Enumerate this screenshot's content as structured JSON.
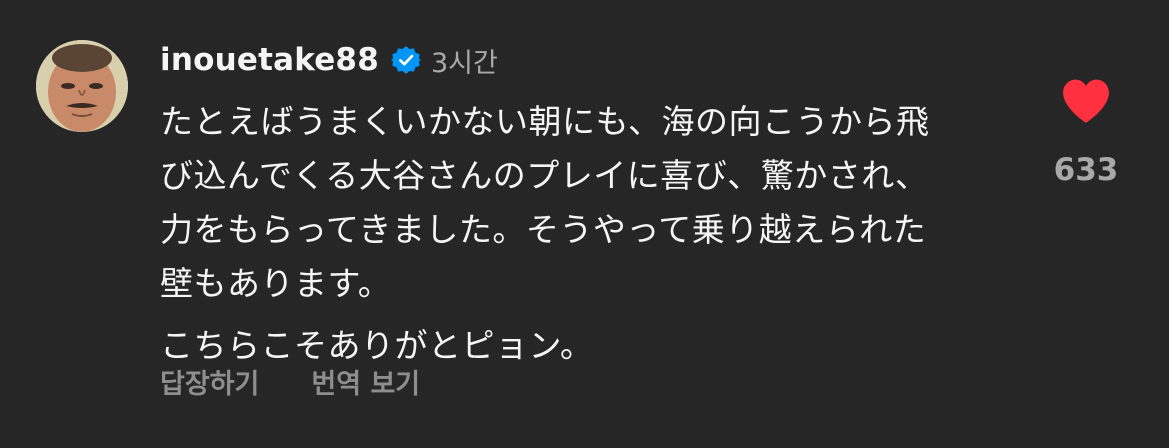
{
  "comment": {
    "username": "inouetake88",
    "verified": true,
    "time": "3시간",
    "paragraphs": [
      {
        "lines": [
          "たとえばうまくいかない朝にも、海の向こうから飛",
          "び込んでくる大谷さんのプレイに喜び、驚かされ、",
          "力をもらってきました。そうやって乗り越えられた",
          "壁もあります。"
        ]
      },
      {
        "lines": [
          "こちらこそありがとピョン。"
        ]
      }
    ],
    "actions": {
      "reply": "답장하기",
      "translate": "번역 보기"
    },
    "like": {
      "count": "633",
      "liked": true
    }
  },
  "icons": {
    "verified": "verified-badge-icon",
    "heart": "heart-icon",
    "avatar": "avatar"
  },
  "colors": {
    "background": "#262626",
    "text": "#f5f5f5",
    "muted": "#a8a8a8",
    "action": "#8e8e8e",
    "verified": "#0095f6",
    "heart": "#ff3040"
  }
}
